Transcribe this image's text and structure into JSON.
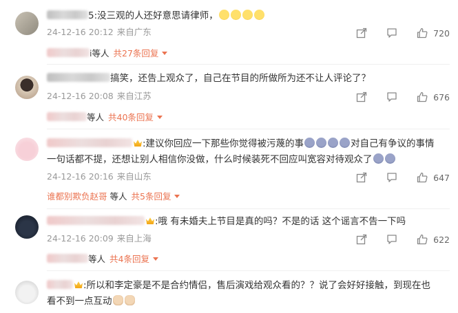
{
  "comments": [
    {
      "name_visible": "5",
      "text": ":没三观的人还好意思请律师，",
      "timestamp": "24-12-16 20:12",
      "location": "来自广东",
      "likes": "720",
      "reply_name": "i",
      "reply_suffix": "等人",
      "reply_count": "共27条回复",
      "emoji": "laugh"
    },
    {
      "name_visible": "",
      "text": "搞笑，还告上观众了，自己在节目的所做所为还不让人评论了？",
      "timestamp": "24-12-16 20:08",
      "location": "来自江苏",
      "likes": "676",
      "reply_name": "",
      "reply_suffix": "等人",
      "reply_count": "共40条回复"
    },
    {
      "name_visible": "",
      "text_line1": ":建议你回应一下那些你觉得被污蔑的事",
      "text_line1b": "对自己有争议的事情",
      "text_line2": "一句话都不提，还想让别人相信你没做，什么时候装死不回应叫宽容对待观众了",
      "timestamp": "24-12-16 20:16",
      "location": "来自山东",
      "likes": "647",
      "reply_name": "谁都别欺负赵哥",
      "reply_suffix": "等人",
      "reply_count": "共5条回复"
    },
    {
      "name_visible": "",
      "text": ":哦 有未婚夫上节目是真的吗？不是的话 这个谣言不告一下吗",
      "timestamp": "24-12-16 20:09",
      "location": "来自上海",
      "likes": "622",
      "reply_name": "",
      "reply_suffix": "等人",
      "reply_count": "共4条回复"
    },
    {
      "name_visible": "",
      "text_line1": ":所以和李定豪是不是合约情侣，售后演戏给观众看的？？说了会好好接触，到现在也",
      "text_line2": "看不到一点互动"
    }
  ],
  "icons": {
    "share": "share-icon",
    "comment": "comment-icon",
    "like": "like-icon"
  },
  "colors": {
    "accent": "#eb7350",
    "meta": "#999999",
    "text": "#333333"
  }
}
